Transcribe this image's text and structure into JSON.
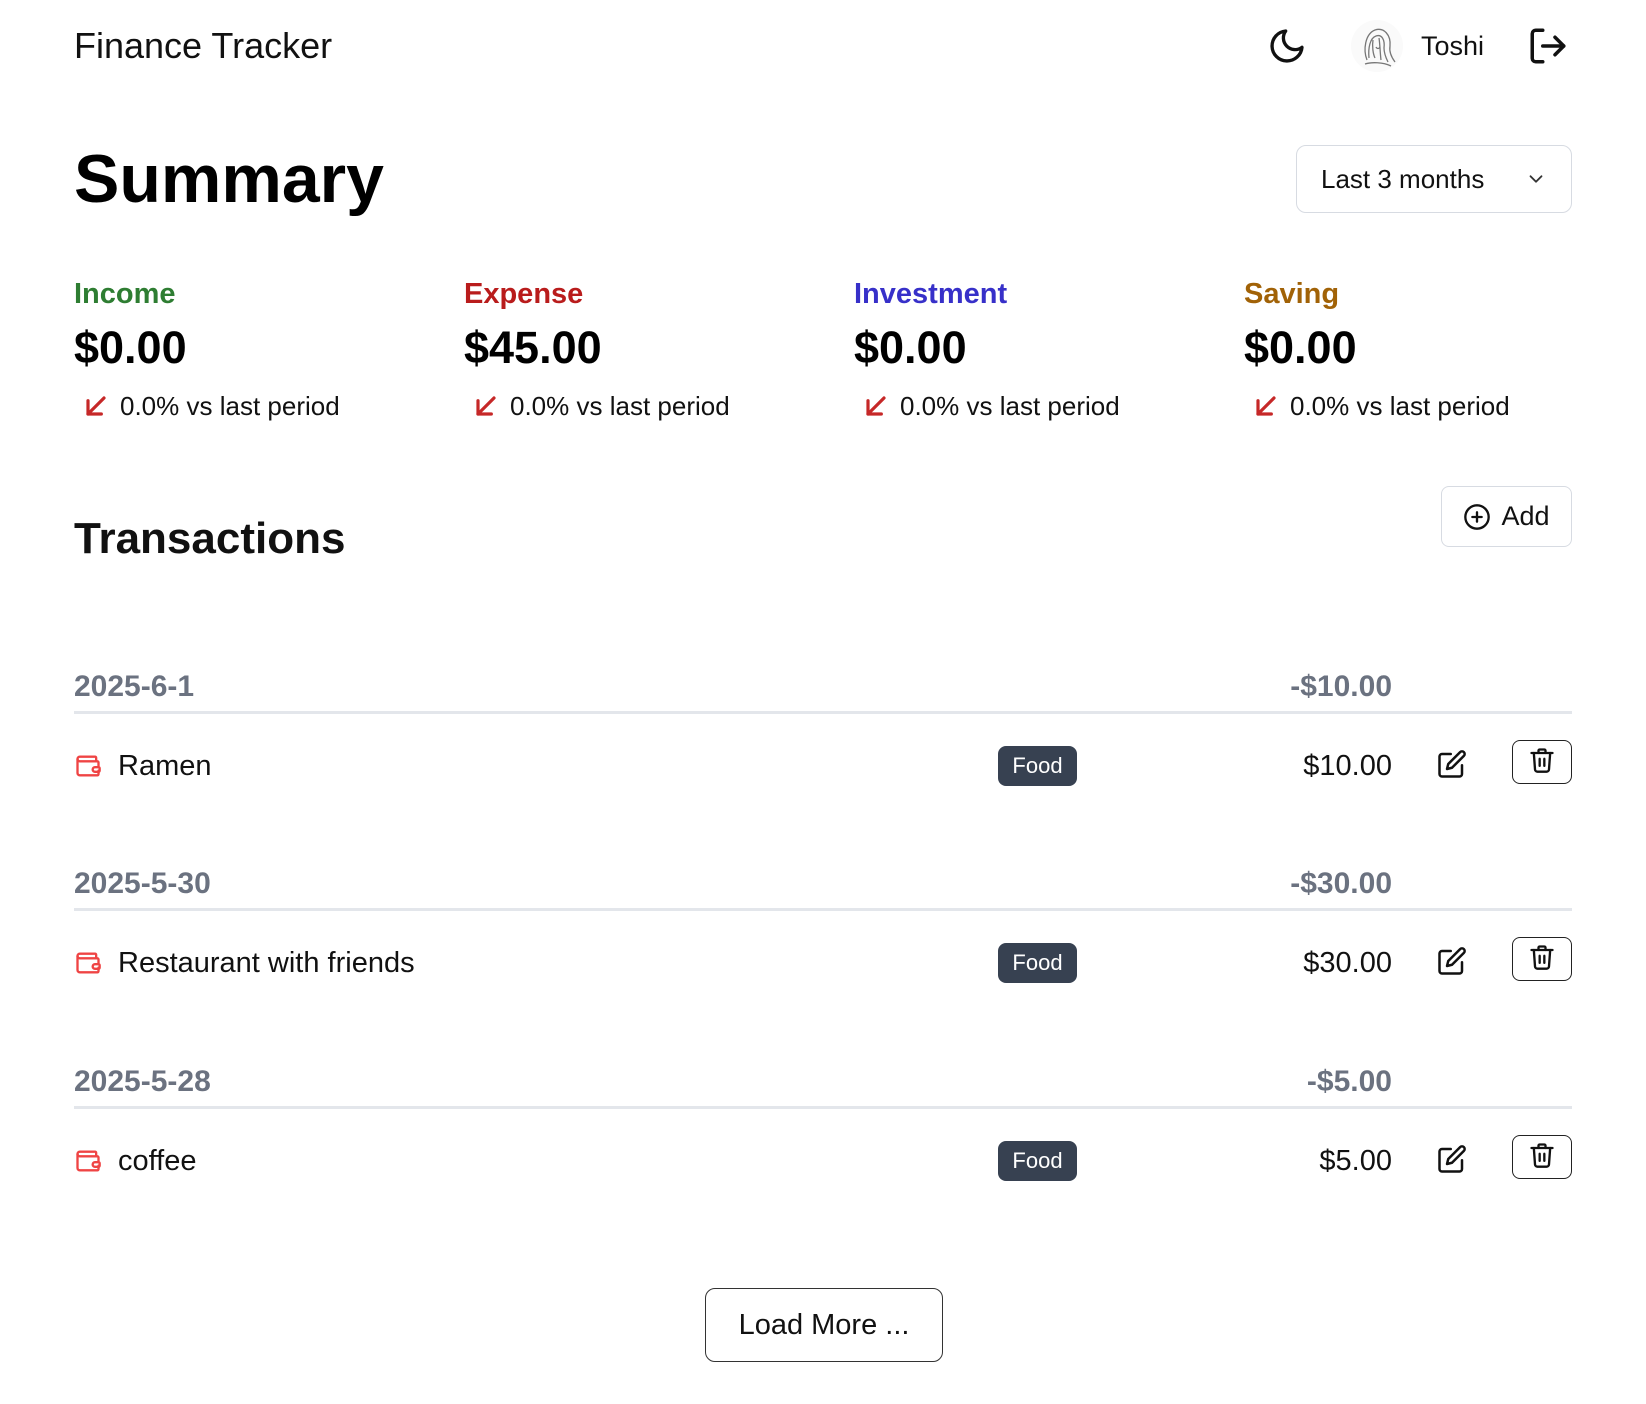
{
  "header": {
    "app_title": "Finance Tracker",
    "user_name": "Toshi",
    "theme_icon": "moon-icon",
    "logout_icon": "logout-icon"
  },
  "summary": {
    "title": "Summary",
    "period": "Last 3 months",
    "stats": [
      {
        "label": "Income",
        "value": "$0.00",
        "change": "0.0% vs last period",
        "color": "#2e7d32"
      },
      {
        "label": "Expense",
        "value": "$45.00",
        "change": "0.0% vs last period",
        "color": "#b91c1c"
      },
      {
        "label": "Investment",
        "value": "$0.00",
        "change": "0.0% vs last period",
        "color": "#3730c9"
      },
      {
        "label": "Saving",
        "value": "$0.00",
        "change": "0.0% vs last period",
        "color": "#a16207"
      }
    ],
    "trend_icon": "arrow-down-left-icon",
    "trend_color": "#c62828"
  },
  "transactions": {
    "title": "Transactions",
    "add_label": "Add",
    "groups": [
      {
        "date": "2025-6-1",
        "total": "-$10.00",
        "items": [
          {
            "name": "Ramen",
            "category": "Food",
            "amount": "$10.00"
          }
        ]
      },
      {
        "date": "2025-5-30",
        "total": "-$30.00",
        "items": [
          {
            "name": "Restaurant with friends",
            "category": "Food",
            "amount": "$30.00"
          }
        ]
      },
      {
        "date": "2025-5-28",
        "total": "-$5.00",
        "items": [
          {
            "name": "coffee",
            "category": "Food",
            "amount": "$5.00"
          }
        ]
      }
    ],
    "load_more_label": "Load More ..."
  },
  "colors": {
    "muted": "#6b7280",
    "badge_bg": "#374151",
    "divider": "#e3e6eb",
    "wallet_icon": "#ef4444"
  }
}
